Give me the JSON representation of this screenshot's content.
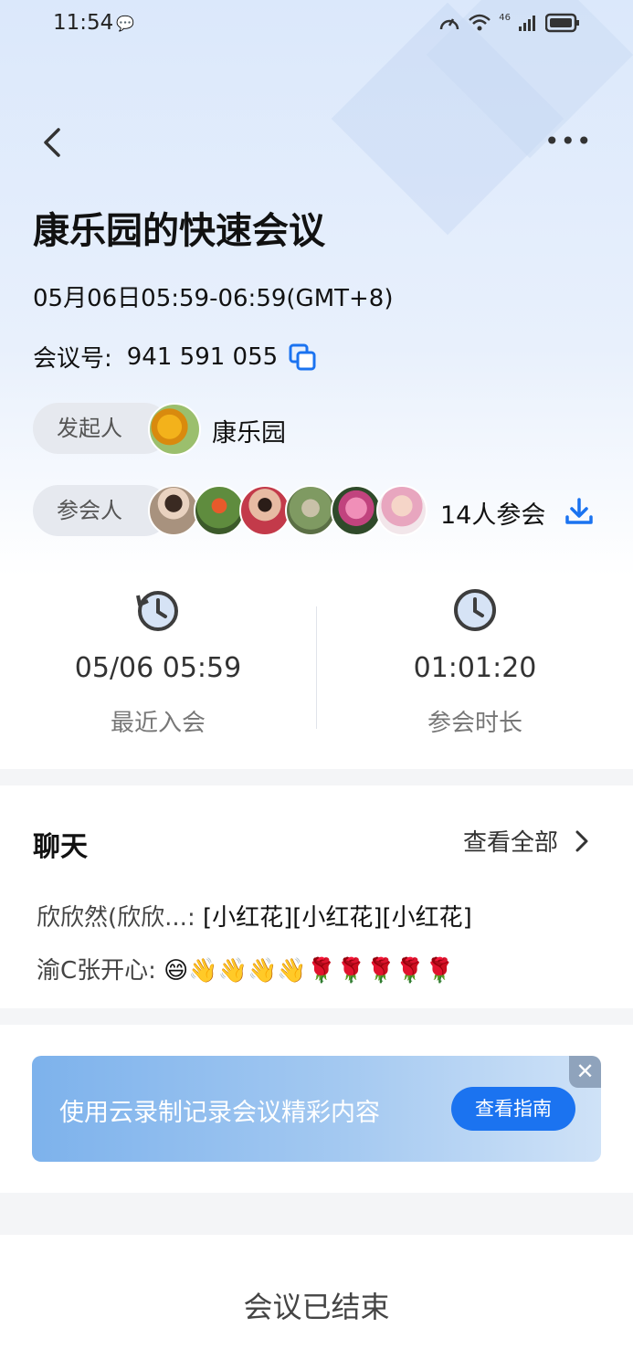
{
  "status_bar": {
    "time": "11:54",
    "wechat_badge": "💬",
    "network": "46"
  },
  "header": {
    "more_label": "•••"
  },
  "meeting": {
    "title": "康乐园的快速会议",
    "time_range": "05月06日05:59-06:59(GMT+8)",
    "id_label": "会议号:",
    "id_value": "941 591 055"
  },
  "host": {
    "pill_label": "发起人",
    "name": "康乐园"
  },
  "participants": {
    "pill_label": "参会人",
    "count_label": "14人参会",
    "avatars": [
      "#b79a86",
      "#6c9a4e",
      "#c9786b",
      "#8a9a6b",
      "#d9669a",
      "#e8b0c0"
    ]
  },
  "stats": [
    {
      "value": "05/06 05:59",
      "label": "最近入会"
    },
    {
      "value": "01:01:20",
      "label": "参会时长"
    }
  ],
  "chat": {
    "title": "聊天",
    "view_all": "查看全部",
    "messages": [
      {
        "sender": "欣欣然(欣欣...:",
        "text": " [小红花][小红花][小红花]"
      },
      {
        "sender": "渝C张开心:",
        "text": " 😄👋👋👋👋🌹🌹🌹🌹🌹"
      }
    ]
  },
  "banner": {
    "text": "使用云录制记录会议精彩内容",
    "button": "查看指南",
    "close": "✕"
  },
  "footer": {
    "status": "会议已结束"
  },
  "colors": {
    "accent": "#1b73f0",
    "pill_bg": "#e6e9ef"
  }
}
